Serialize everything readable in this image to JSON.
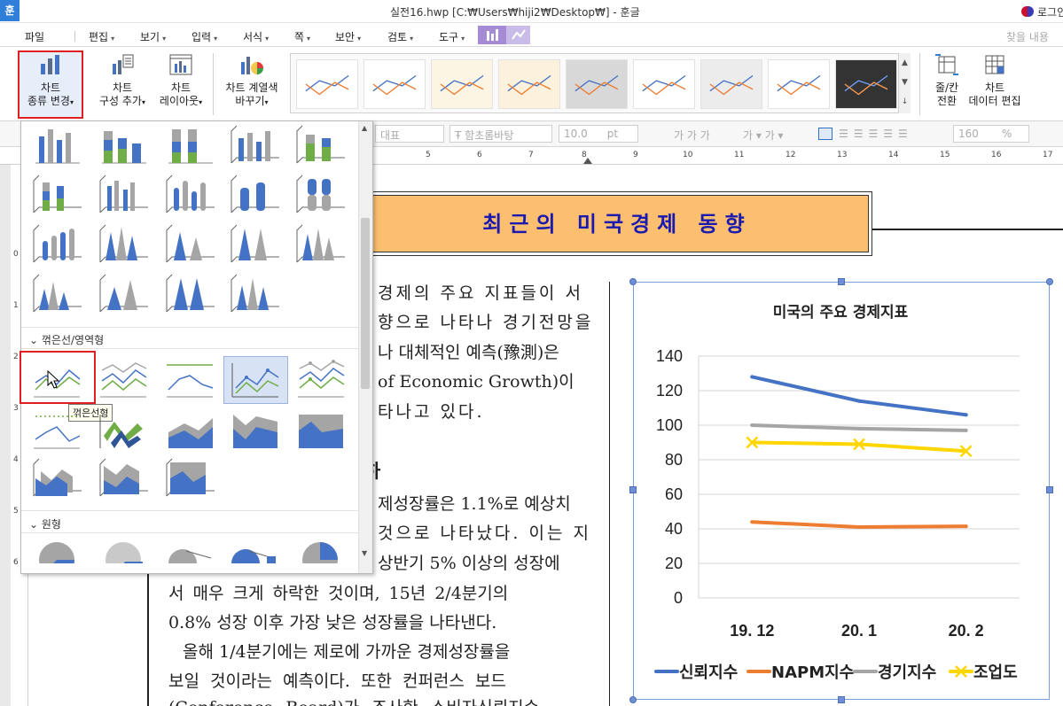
{
  "window": {
    "app_icon": "훈",
    "title": "실전16.hwp [C:₩Users₩hiji2₩Desktop₩] - 훈글",
    "login": "로그인"
  },
  "menu": {
    "items": [
      "파일",
      "편집",
      "보기",
      "입력",
      "서식",
      "쪽",
      "보안",
      "검토",
      "도구"
    ],
    "find_placeholder": "찾을 내용"
  },
  "ribbon": {
    "chart_type_change": [
      "차트",
      "종류 변경"
    ],
    "add_element": [
      "차트",
      "구성 추가"
    ],
    "layout": [
      "차트",
      "레이아웃"
    ],
    "color_change": [
      "차트 계열색",
      "바꾸기"
    ],
    "row_col_switch": [
      "줄/칸",
      "전환"
    ],
    "edit_data": [
      "차트",
      "데이터 편집"
    ]
  },
  "format_toolbar": {
    "style": "대표",
    "font": "함초롬바탕",
    "size": "10.0",
    "size_unit": "pt",
    "bold_italic_underline": "가  가  가",
    "zoom": "160",
    "zoom_unit": "%"
  },
  "ruler": {
    "h_ticks": [
      "5",
      "6",
      "7",
      "8",
      "9",
      "10",
      "11",
      "12",
      "13",
      "14",
      "15",
      "16",
      "17"
    ],
    "v_ticks": [
      "0",
      "1",
      "2",
      "3",
      "4",
      "5",
      "6"
    ]
  },
  "dropdown": {
    "category_line": "꺾은선/영역형",
    "category_pie": "원형",
    "tooltip": "꺾은선형"
  },
  "document": {
    "title": "최근의 미국경제 동향",
    "body_lines": [
      "경제의 주요 지표들이 서",
      "향으로 나타나 경기전망을",
      "나 대체적인 예측(豫測)은",
      "of Economic Growth)이",
      "타나고 있다.",
      "하",
      "제성장률은 1.1%로 예상치",
      "것으로 나타났다. 이는 지",
      "상반기 5% 이상의 성장에",
      "서 매우 크게 하락한 것이며, 15년 2/4분기의",
      "0.8% 성장 이후 가장 낮은 성장률을 나타낸다.",
      "올해 1/4분기에는 제로에 가까운 경제성장률을",
      "보일 것이라는 예측이다. 또한 컨퍼런스 보드",
      "(Conference Board)가 조사한 소비자신뢰지수"
    ]
  },
  "chart_data": {
    "type": "line",
    "title": "미국의 주요 경제지표",
    "categories": [
      "19. 12",
      "20. 1",
      "20. 2"
    ],
    "ylim": [
      0,
      140
    ],
    "yticks": [
      0,
      20,
      40,
      60,
      80,
      100,
      120,
      140
    ],
    "grid": true,
    "legend_position": "bottom",
    "series": [
      {
        "name": "신뢰지수",
        "values": [
          128,
          114,
          106
        ],
        "color": "#4472c4",
        "marker": "none"
      },
      {
        "name": "NAPM지수",
        "values": [
          44,
          41,
          41.5
        ],
        "color": "#ed7d31",
        "marker": "none"
      },
      {
        "name": "경기지수",
        "values": [
          100,
          98,
          97
        ],
        "color": "#a5a5a5",
        "marker": "none"
      },
      {
        "name": "조업도",
        "values": [
          90,
          89,
          85
        ],
        "color": "#ffd600",
        "marker": "x"
      }
    ]
  }
}
